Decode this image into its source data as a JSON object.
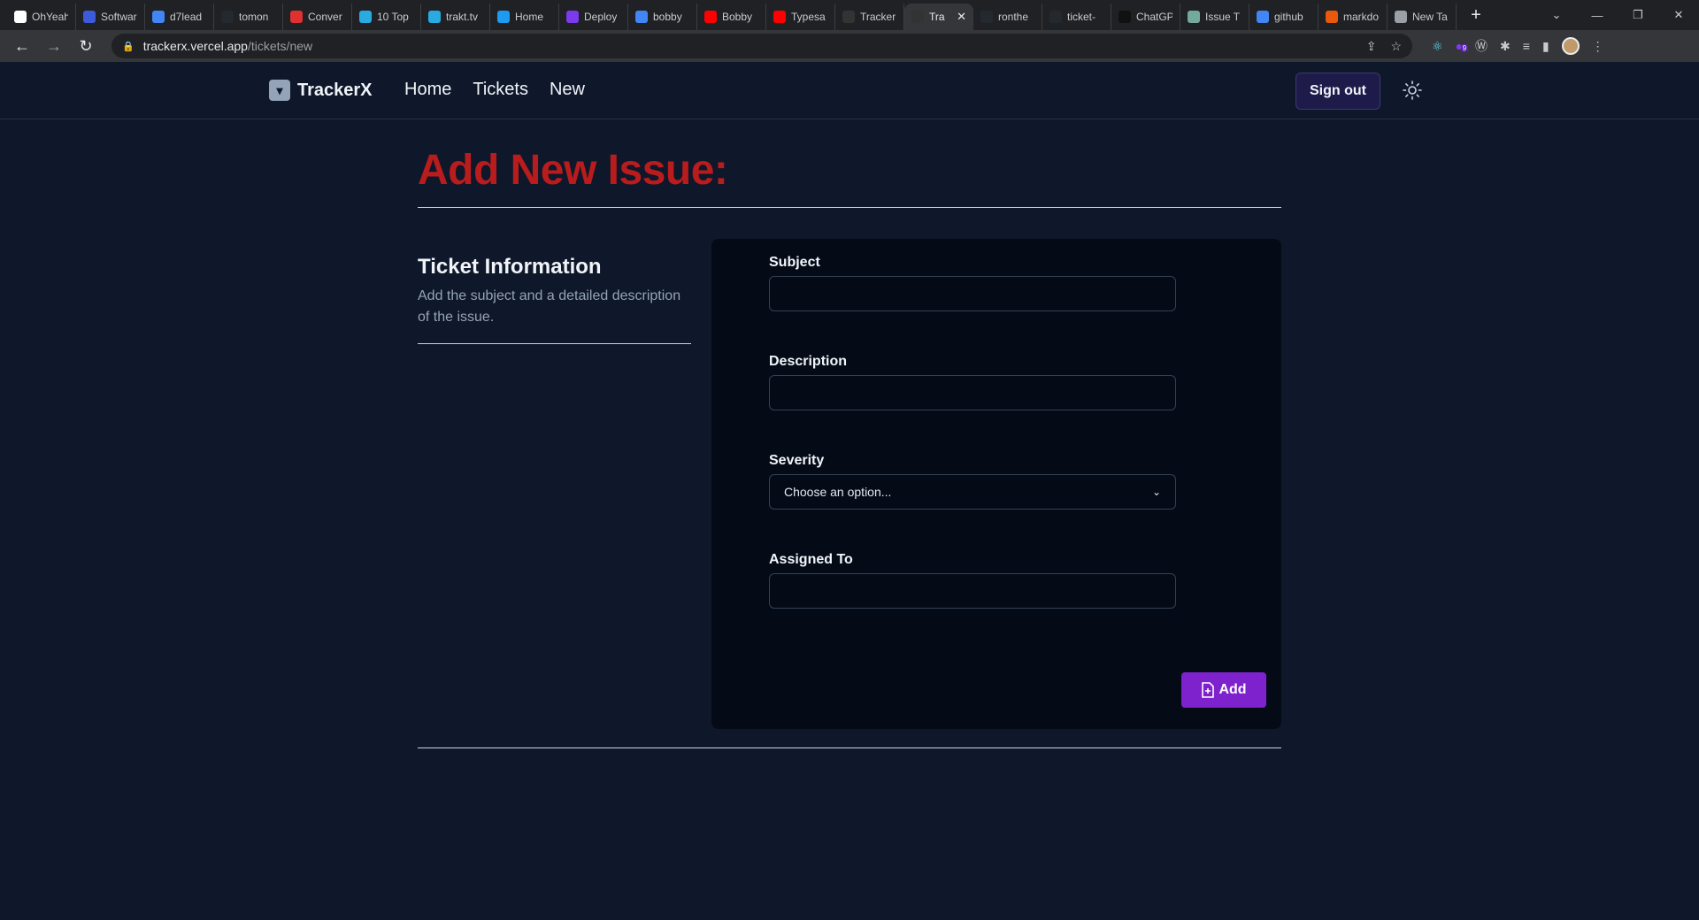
{
  "browser": {
    "tabs": [
      {
        "title": "OhYeah",
        "icon": "w-icon",
        "color": "#ffffff"
      },
      {
        "title": "Software",
        "icon": "a-icon",
        "color": "#3b5bdb"
      },
      {
        "title": "d7lead",
        "icon": "google-icon",
        "color": "#4285f4"
      },
      {
        "title": "tomon",
        "icon": "github-icon",
        "color": "#24292f"
      },
      {
        "title": "Conver",
        "icon": "ring-icon",
        "color": "#e03131"
      },
      {
        "title": "10 Top",
        "icon": "snowflake-icon",
        "color": "#29abe2"
      },
      {
        "title": "trakt.tv",
        "icon": "snowflake-icon",
        "color": "#29abe2"
      },
      {
        "title": "Home",
        "icon": "twitter-icon",
        "color": "#1d9bf0"
      },
      {
        "title": "Deploy",
        "icon": "d-icon",
        "color": "#7c3aed"
      },
      {
        "title": "bobby",
        "icon": "google-icon",
        "color": "#4285f4"
      },
      {
        "title": "Bobby",
        "icon": "youtube-icon",
        "color": "#ff0000"
      },
      {
        "title": "Typesa",
        "icon": "youtube-icon",
        "color": "#ff0000"
      },
      {
        "title": "Tracker",
        "icon": "tracker-icon",
        "color": "#333333"
      },
      {
        "title": "Tra",
        "icon": "tracker-icon",
        "color": "#333333",
        "active": true
      },
      {
        "title": "ronthe",
        "icon": "github-icon",
        "color": "#24292f"
      },
      {
        "title": "ticket-",
        "icon": "github-icon",
        "color": "#24292f"
      },
      {
        "title": "ChatGP",
        "icon": "openai-icon",
        "color": "#111111"
      },
      {
        "title": "Issue T",
        "icon": "chatgpt-icon",
        "color": "#74aa9c"
      },
      {
        "title": "github",
        "icon": "google-icon",
        "color": "#4285f4"
      },
      {
        "title": "markdo",
        "icon": "fire-icon",
        "color": "#e8590c"
      },
      {
        "title": "New Ta",
        "icon": "chrome-icon",
        "color": "#9aa0a6"
      }
    ],
    "url_host": "trackerx.vercel.app",
    "url_path": "/tickets/new",
    "ext_badge": "9"
  },
  "nav": {
    "brand": "TrackerX",
    "links": [
      "Home",
      "Tickets",
      "New"
    ],
    "sign_out": "Sign out"
  },
  "page": {
    "title": "Add New Issue:",
    "section_title": "Ticket Information",
    "section_desc": "Add the subject and a detailed description of the issue."
  },
  "form": {
    "subject_label": "Subject",
    "subject_value": "",
    "description_label": "Description",
    "description_value": "",
    "severity_label": "Severity",
    "severity_selected": "Choose an option...",
    "assigned_label": "Assigned To",
    "assigned_value": "",
    "add_button": "Add"
  },
  "colors": {
    "title_red": "#b91c1c",
    "add_purple": "#7e22ce",
    "bg": "#0f172a"
  }
}
